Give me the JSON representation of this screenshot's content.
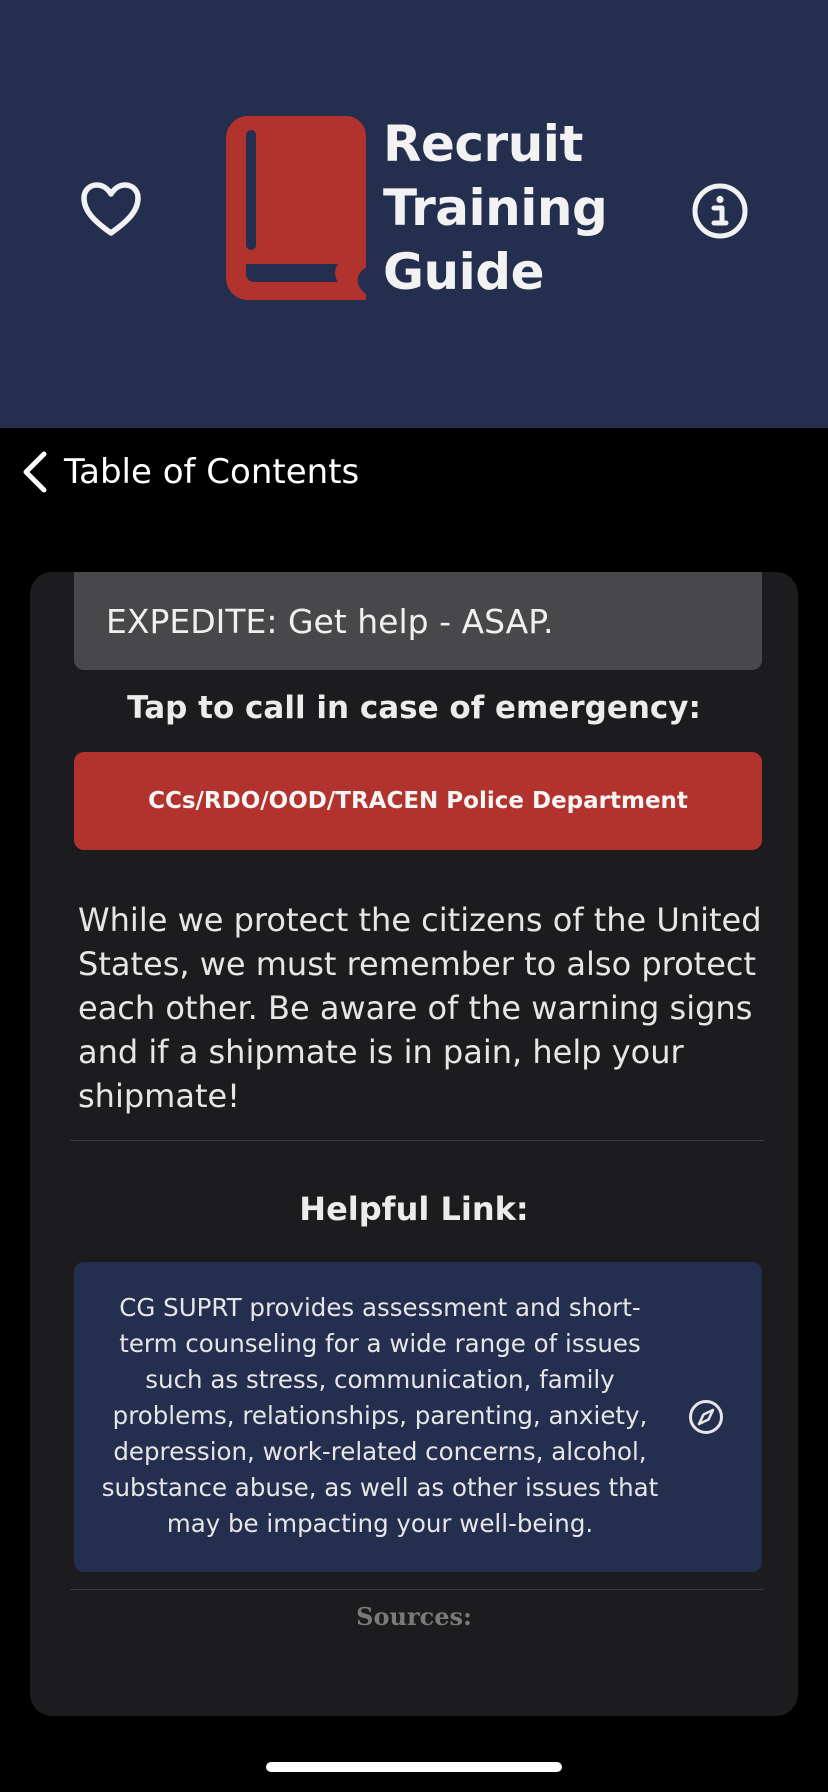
{
  "header": {
    "title_lines": [
      "Recruit",
      "Training",
      "Guide"
    ],
    "favorite_icon": "heart-icon",
    "info_icon": "info-circle-icon",
    "logo_icon": "book-icon",
    "brand_color": "#242e4f",
    "accent_color": "#b2322d"
  },
  "nav": {
    "back_label": "Table of Contents",
    "back_icon": "chevron-left-icon"
  },
  "content": {
    "expedite_text": "EXPEDITE: Get help - ASAP.",
    "emergency_heading": "Tap to call in case of emergency:",
    "call_button_label": "CCs/RDO/OOD/TRACEN Police Department",
    "body_paragraph": "While we protect the citizens of the United States, we must remember to also protect each other. Be aware of the warning signs and if a shipmate is in pain, help your shipmate!",
    "helpful_link_heading": "Helpful Link:",
    "helpful_link_text": "CG SUPRT provides assessment and short-term counseling for a wide range of issues such as stress, communication, family problems, relationships, parenting, anxiety, depression, work-related concerns, alcohol, substance abuse, as well as other issues that may be impacting your well-being.",
    "helpful_link_icon": "compass-icon",
    "sources_heading": "Sources:"
  }
}
